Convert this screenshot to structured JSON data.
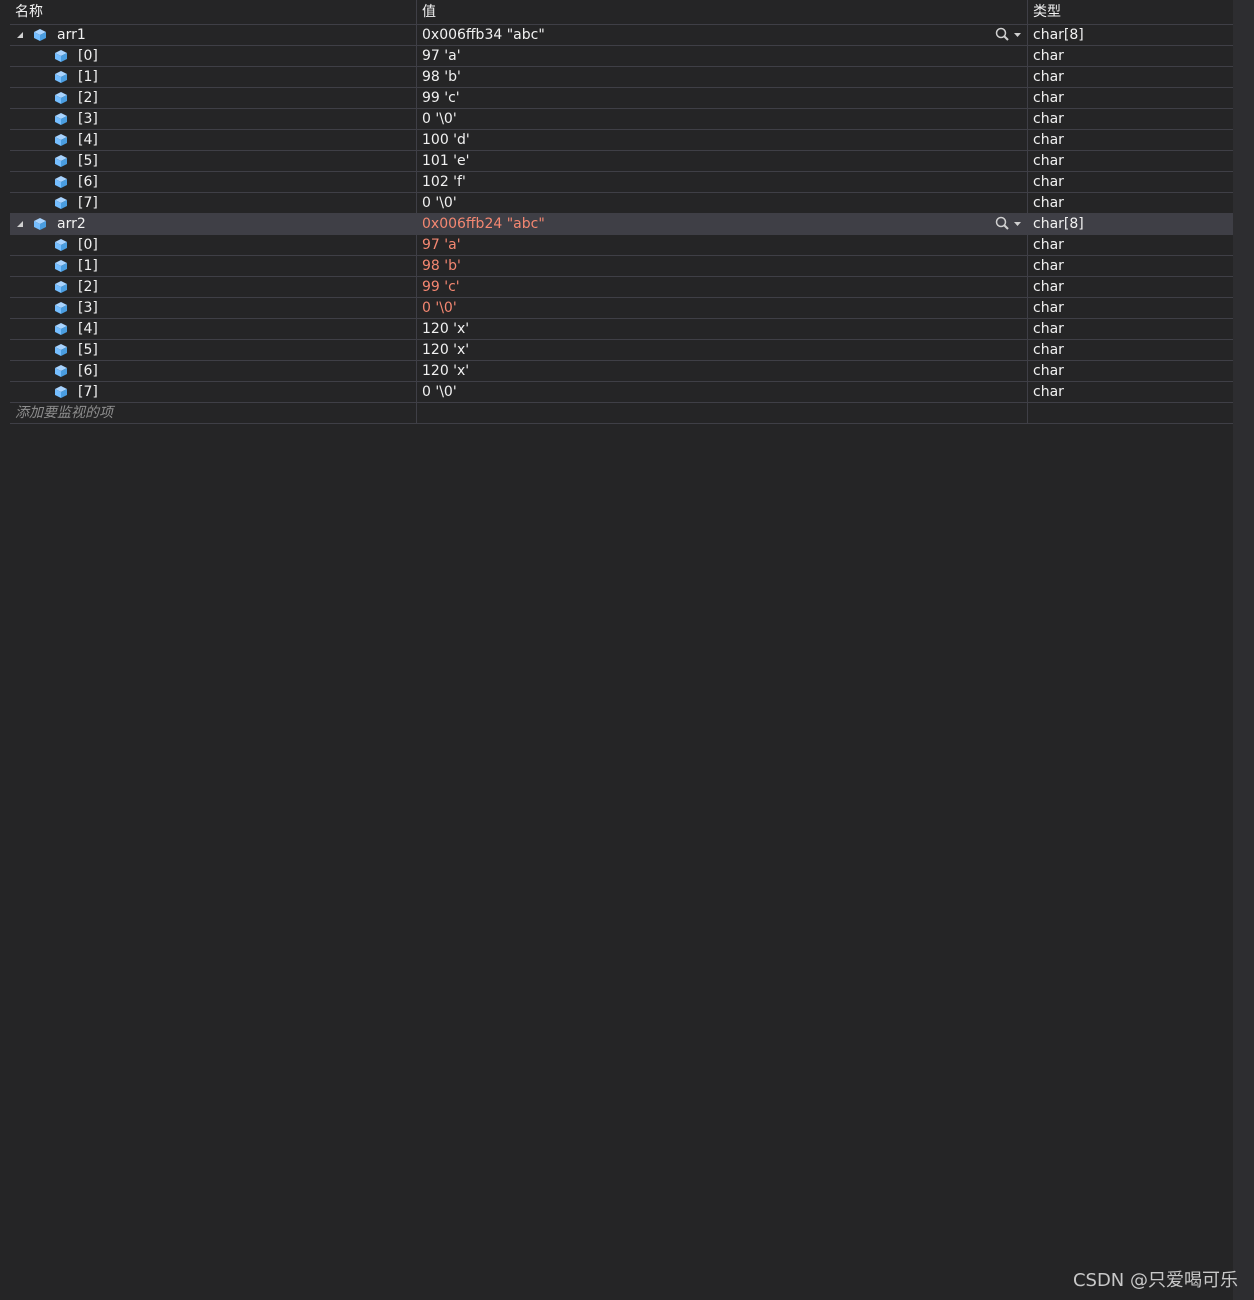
{
  "columns": {
    "name": "名称",
    "value": "值",
    "type": "类型"
  },
  "groups": [
    {
      "name": "arr1",
      "value": "0x006ffb34 \"abc\"",
      "type": "char[8]",
      "children": [
        {
          "name": "[0]",
          "value": "97 'a'",
          "type": "char"
        },
        {
          "name": "[1]",
          "value": "98 'b'",
          "type": "char"
        },
        {
          "name": "[2]",
          "value": "99 'c'",
          "type": "char"
        },
        {
          "name": "[3]",
          "value": "0 '\\0'",
          "type": "char"
        },
        {
          "name": "[4]",
          "value": "100 'd'",
          "type": "char"
        },
        {
          "name": "[5]",
          "value": "101 'e'",
          "type": "char"
        },
        {
          "name": "[6]",
          "value": "102 'f'",
          "type": "char"
        },
        {
          "name": "[7]",
          "value": "0 '\\0'",
          "type": "char"
        }
      ]
    },
    {
      "name": "arr2",
      "value": "0x006ffb24 \"abc\"",
      "type": "char[8]",
      "children": [
        {
          "name": "[0]",
          "value": "97 'a'",
          "type": "char"
        },
        {
          "name": "[1]",
          "value": "98 'b'",
          "type": "char"
        },
        {
          "name": "[2]",
          "value": "99 'c'",
          "type": "char"
        },
        {
          "name": "[3]",
          "value": "0 '\\0'",
          "type": "char"
        },
        {
          "name": "[4]",
          "value": "120 'x'",
          "type": "char"
        },
        {
          "name": "[5]",
          "value": "120 'x'",
          "type": "char"
        },
        {
          "name": "[6]",
          "value": "120 'x'",
          "type": "char"
        },
        {
          "name": "[7]",
          "value": "0 '\\0'",
          "type": "char"
        }
      ]
    }
  ],
  "add_watch_placeholder": "添加要监视的项",
  "watermark": "CSDN @只爱喝可乐",
  "colors": {
    "background": "#252526",
    "grid": "#3f3f46",
    "changed_value": "#f48771",
    "cube_icon": "#75beff",
    "selected_row": "#3f3f46"
  }
}
